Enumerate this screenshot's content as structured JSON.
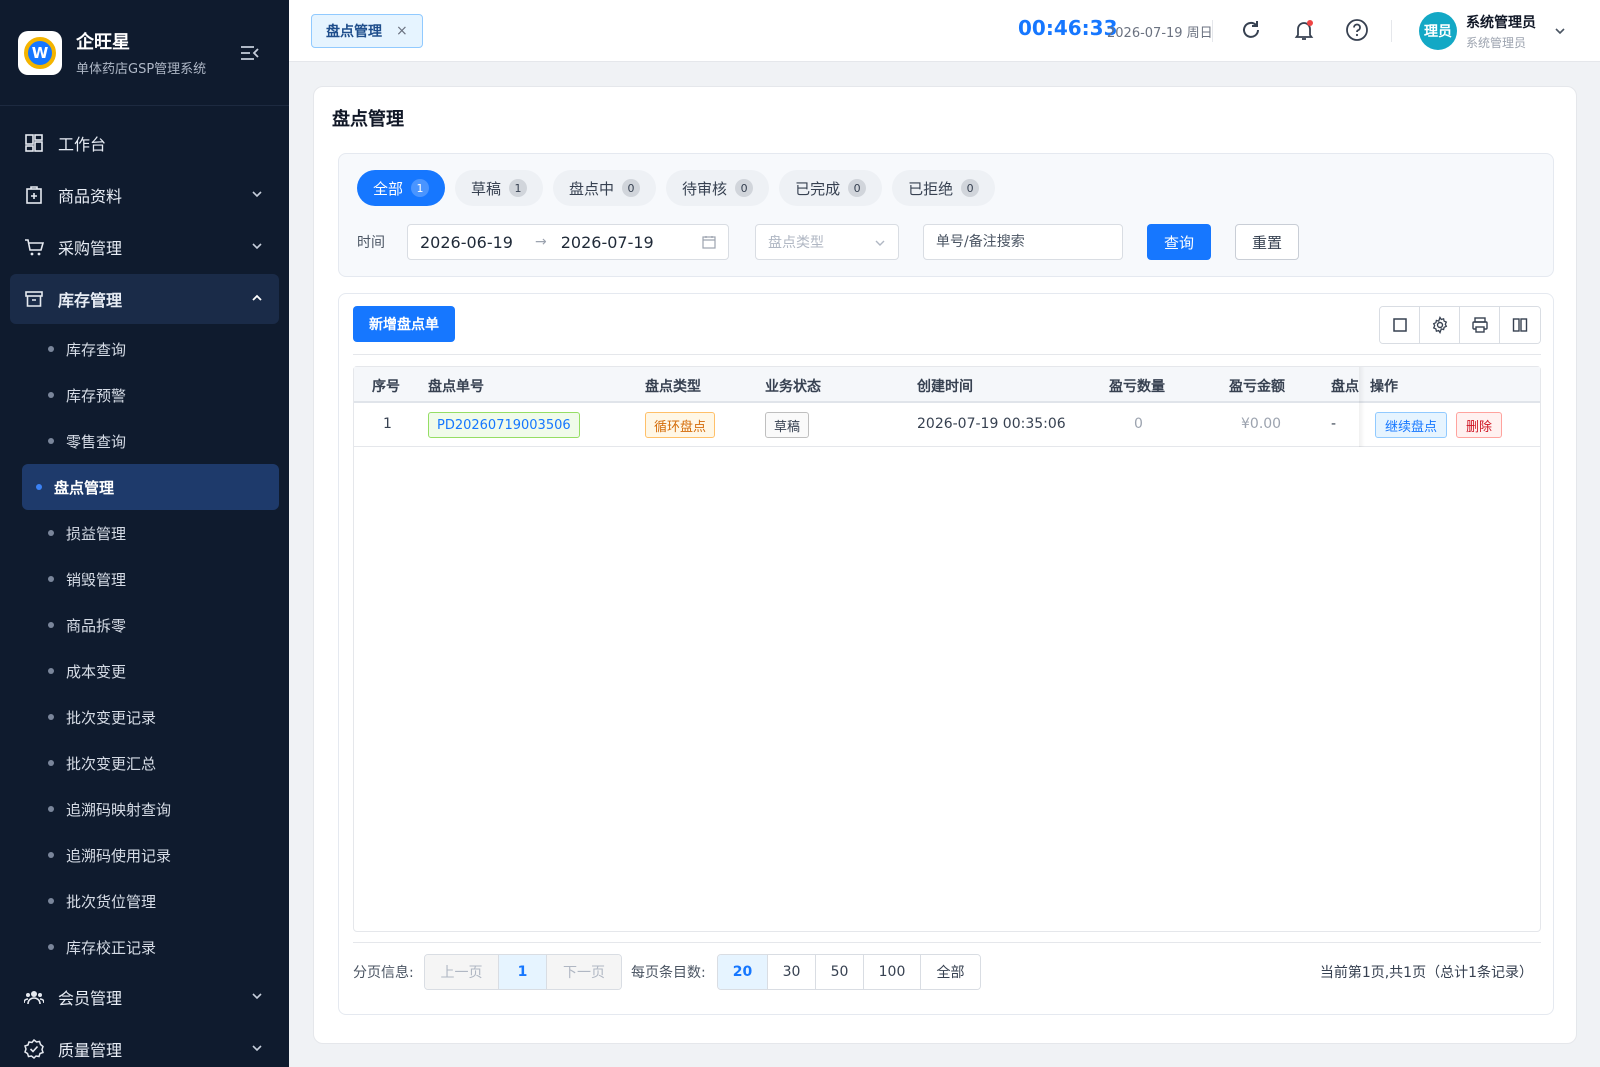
{
  "brand": {
    "name": "企旺星",
    "subtitle": "单体药店GSP管理系统",
    "logo_letter": "W"
  },
  "sidebar": {
    "items": [
      {
        "label": "工作台",
        "icon": "dashboard-icon"
      },
      {
        "label": "商品资料",
        "icon": "product-icon"
      },
      {
        "label": "采购管理",
        "icon": "cart-icon"
      },
      {
        "label": "库存管理",
        "icon": "warehouse-icon"
      }
    ],
    "sub_items": [
      "库存查询",
      "库存预警",
      "零售查询",
      "盘点管理",
      "损益管理",
      "销毁管理",
      "商品拆零",
      "成本变更",
      "批次变更记录",
      "批次变更汇总",
      "追溯码映射查询",
      "追溯码使用记录",
      "批次货位管理",
      "库存校正记录"
    ],
    "bottom_items": [
      {
        "label": "会员管理",
        "icon": "members-icon"
      },
      {
        "label": "质量管理",
        "icon": "quality-icon"
      }
    ]
  },
  "header": {
    "tab_label": "盘点管理",
    "tab_close": "×",
    "clock": "00:46:33",
    "date": "2026-07-19 周日",
    "user_name": "系统管理员",
    "user_role": "系统管理员",
    "avatar_text": "理员"
  },
  "page": {
    "title": "盘点管理",
    "status_tabs": [
      {
        "label": "全部",
        "count": "1"
      },
      {
        "label": "草稿",
        "count": "1"
      },
      {
        "label": "盘点中",
        "count": "0"
      },
      {
        "label": "待审核",
        "count": "0"
      },
      {
        "label": "已完成",
        "count": "0"
      },
      {
        "label": "已拒绝",
        "count": "0"
      }
    ],
    "filter": {
      "time_label": "时间",
      "date_from": "2026-06-19",
      "date_arrow": "→",
      "date_to": "2026-07-19",
      "type_placeholder": "盘点类型",
      "search_placeholder": "单号/备注搜索",
      "query_button": "查询",
      "reset_button": "重置"
    },
    "add_button": "新增盘点单",
    "columns": [
      "序号",
      "盘点单号",
      "盘点类型",
      "业务状态",
      "创建时间",
      "盈亏数量",
      "盈亏金额",
      "盘点",
      "操作"
    ],
    "rows": [
      {
        "index": "1",
        "order_no": "PD20260719003506",
        "type": "循环盘点",
        "status": "草稿",
        "created": "2026-07-19 00:35:06",
        "qty": "0",
        "amount": "¥0.00",
        "counter": "-",
        "op_continue": "继续盘点",
        "op_delete": "删除"
      }
    ],
    "pager": {
      "info_label": "分页信息:",
      "prev": "上一页",
      "current": "1",
      "next": "下一页",
      "size_label": "每页条目数:",
      "sizes": [
        "20",
        "30",
        "50",
        "100",
        "全部"
      ],
      "summary": "当前第1页,共1页（总计1条记录）"
    }
  },
  "colors": {
    "primary": "#1677ff",
    "sidebar_bg": "#0f1b2e",
    "active_sub": "#1e3a6b"
  }
}
